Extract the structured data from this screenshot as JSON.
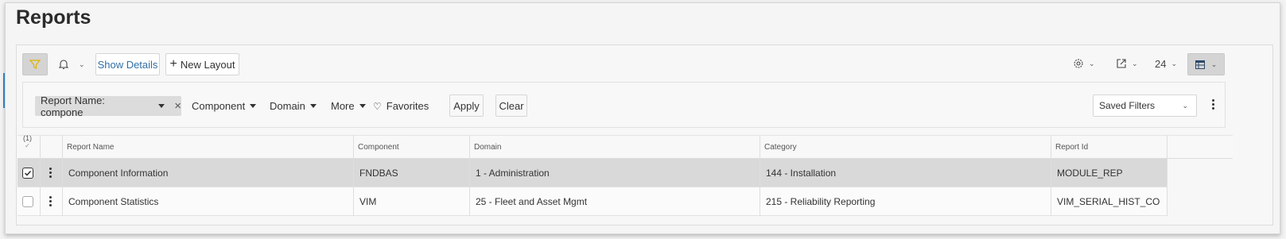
{
  "page": {
    "title": "Reports"
  },
  "toolbar": {
    "show_details_label": "Show Details",
    "new_layout_label": "New Layout",
    "page_size": "24"
  },
  "filters": {
    "chip_label": "Report Name: compone",
    "component_label": "Component",
    "domain_label": "Domain",
    "more_label": "More",
    "favorites_label": "Favorites",
    "apply_label": "Apply",
    "clear_label": "Clear",
    "saved_filters_label": "Saved Filters"
  },
  "table": {
    "selection_count": "(1)",
    "columns": [
      "Report Name",
      "Component",
      "Domain",
      "Category",
      "Report Id"
    ],
    "rows": [
      {
        "selected": true,
        "report_name": "Component Information",
        "component": "FNDBAS",
        "domain": "1 - Administration",
        "category": "144 - Installation",
        "report_id": "MODULE_REP"
      },
      {
        "selected": false,
        "report_name": "Component Statistics",
        "component": "VIM",
        "domain": "25 - Fleet and Asset Mgmt",
        "category": "215 - Reliability Reporting",
        "report_id": "VIM_SERIAL_HIST_COM..."
      }
    ]
  },
  "colors": {
    "accent": "#2f7fc1",
    "selected_row": "#d9d9d9",
    "filter_active": "#d4d4d4"
  }
}
